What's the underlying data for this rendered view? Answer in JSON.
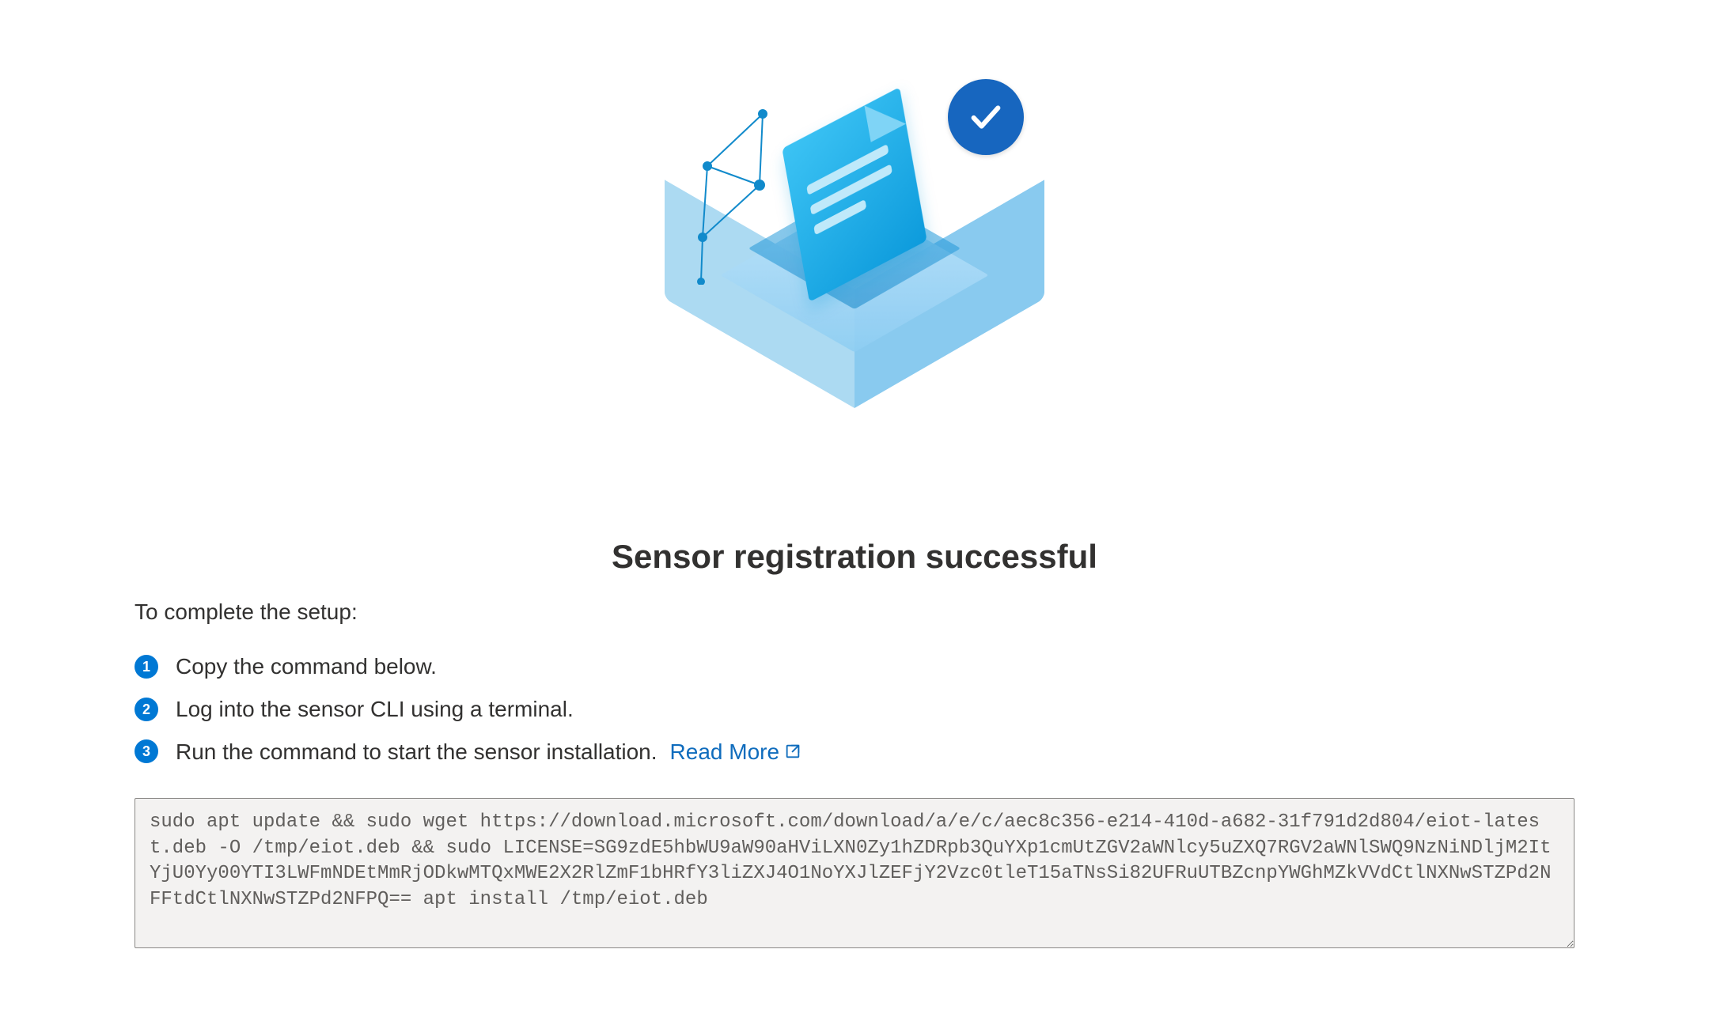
{
  "title": "Sensor registration successful",
  "lead": "To complete the setup:",
  "steps": [
    "Copy the command below.",
    "Log into the sensor CLI using a terminal.",
    "Run the command to start the sensor installation."
  ],
  "read_more_label": "Read More",
  "command": "sudo apt update && sudo wget https://download.microsoft.com/download/a/e/c/aec8c356-e214-410d-a682-31f791d2d804/eiot-latest.deb -O /tmp/eiot.deb && sudo LICENSE=SG9zdE5hbWU9aW90aHViLXN0Zy1hZDRpb3QuYXp1cmUtZGV2aWNlcy5uZXQ7RGV2aWNlSWQ9NzNiNDljM2ItYjU0Yy00YTI3LWFmNDEtMmRjODkwMTQxMWE2X2RlZmF1bHRfY3liZXJ4O1NoYXJlZEFjY2Vzc0tleT15aTNsSi82UFRuUTBZcnpYWGhMZkVVdCtlNXNwSTZPd2NFFtdCtlNXNwSTZPd2NFPQ== apt install /tmp/eiot.deb",
  "icons": {
    "check": "check-icon",
    "external": "external-link-icon",
    "illustration": "sensor-box-illustration"
  },
  "colors": {
    "accent": "#0078d4",
    "link": "#0f6cbd",
    "badge": "#1766bf"
  }
}
